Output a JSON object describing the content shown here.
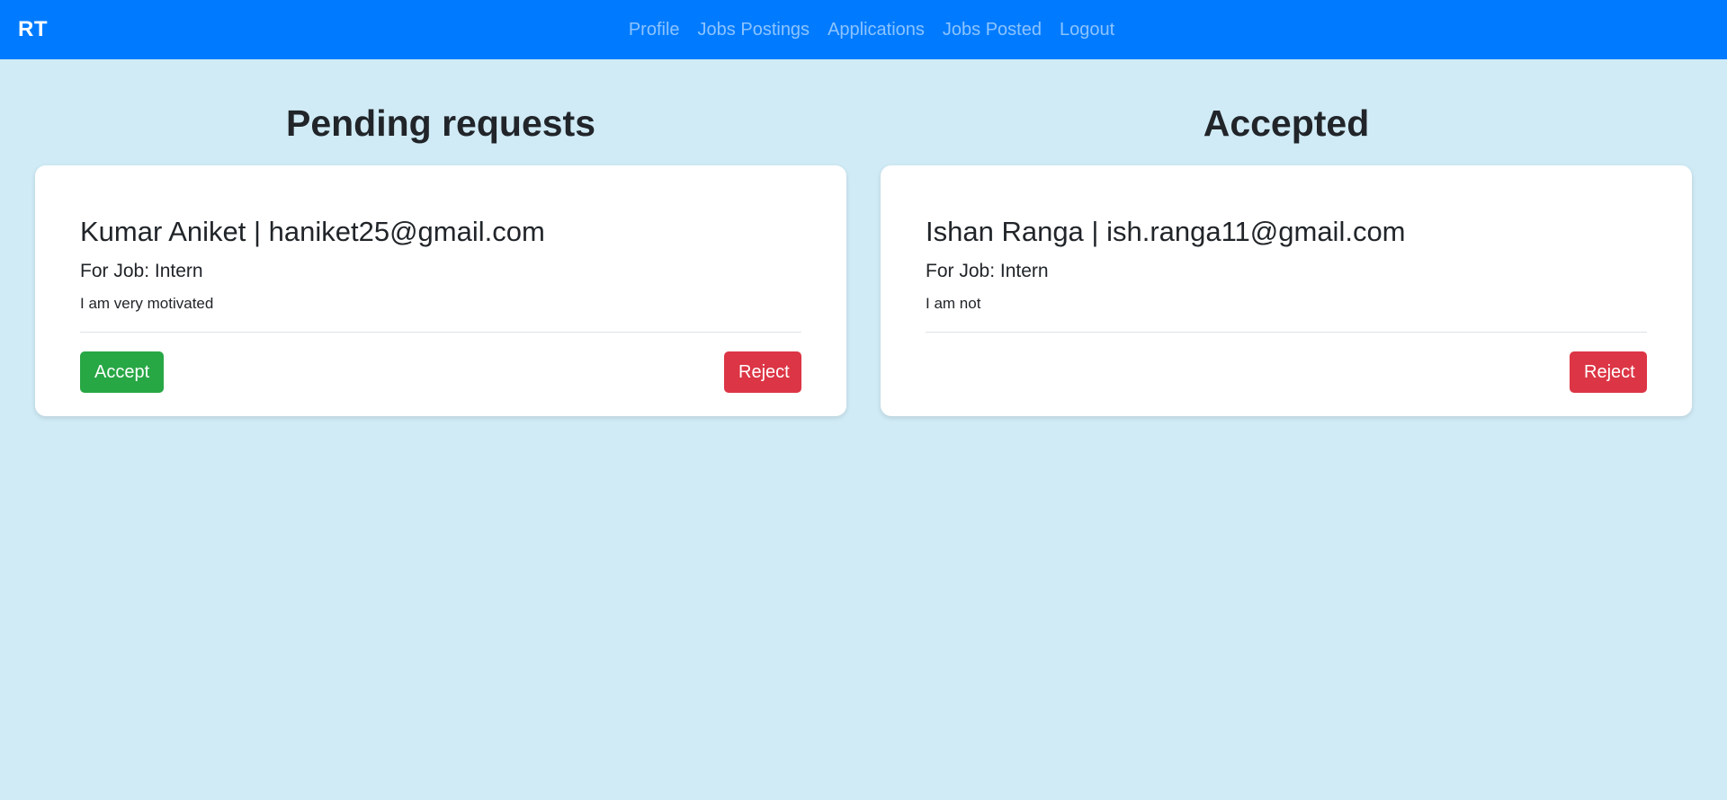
{
  "navbar": {
    "brand": "RT",
    "links": [
      "Profile",
      "Jobs Postings",
      "Applications",
      "Jobs Posted",
      "Logout"
    ]
  },
  "pending": {
    "title": "Pending requests",
    "cards": [
      {
        "name_email": "Kumar Aniket | haniket25@gmail.com",
        "job": "For Job: Intern",
        "message": "I am very motivated",
        "accept_label": "Accept",
        "reject_label": "Reject"
      }
    ]
  },
  "accepted": {
    "title": "Accepted",
    "cards": [
      {
        "name_email": "Ishan Ranga | ish.ranga11@gmail.com",
        "job": "For Job: Intern",
        "message": "I am not",
        "reject_label": "Reject"
      }
    ]
  },
  "colors": {
    "navbar_bg": "#007bff",
    "page_bg": "#d0ebf6",
    "accept": "#28a745",
    "reject": "#dc3545"
  }
}
